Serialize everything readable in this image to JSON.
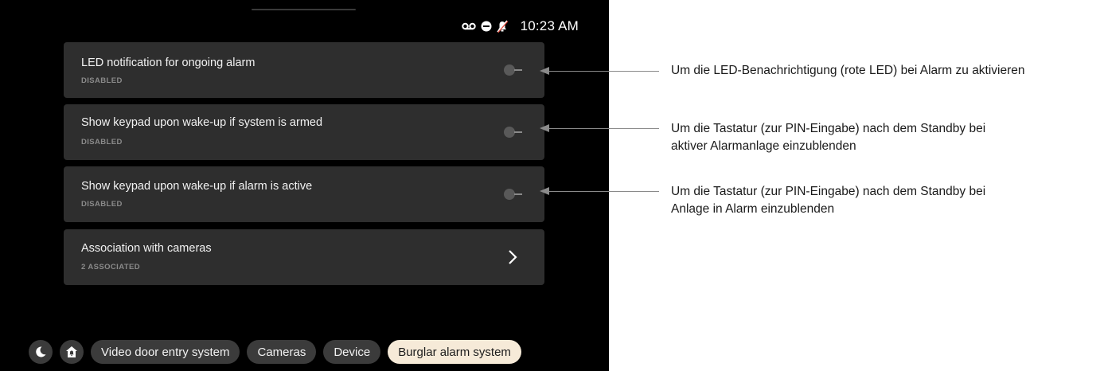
{
  "status_bar": {
    "time": "10:23 AM",
    "icons": [
      "voicemail-icon",
      "do-not-disturb-icon",
      "muted-bell-icon"
    ]
  },
  "settings": [
    {
      "title": "LED notification for ongoing alarm",
      "subtitle": "DISABLED",
      "control": "toggle",
      "enabled": false
    },
    {
      "title": "Show keypad upon wake-up if system is armed",
      "subtitle": "DISABLED",
      "control": "toggle",
      "enabled": false
    },
    {
      "title": "Show keypad upon wake-up if alarm is active",
      "subtitle": "DISABLED",
      "control": "toggle",
      "enabled": false
    },
    {
      "title": "Association with cameras",
      "subtitle": "2 ASSOCIATED",
      "control": "chevron"
    }
  ],
  "nav": {
    "icons": [
      "moon-icon",
      "home-alarm-icon"
    ],
    "tabs": [
      {
        "label": "Video door entry system",
        "active": false
      },
      {
        "label": "Cameras",
        "active": false
      },
      {
        "label": "Device",
        "active": false
      },
      {
        "label": "Burglar alarm system",
        "active": true
      }
    ]
  },
  "annotations": [
    {
      "line1": "Um die LED-Benachrichtigung (rote LED) bei Alarm zu aktivieren",
      "line2": ""
    },
    {
      "line1": "Um die Tastatur (zur PIN-Eingabe) nach dem Standby bei",
      "line2": "aktiver Alarmanlage einzublenden"
    },
    {
      "line1": "Um die Tastatur (zur PIN-Eingabe) nach dem Standby bei",
      "line2": "Anlage in Alarm einzublenden"
    }
  ],
  "colors": {
    "screen_bg": "#000000",
    "card_bg": "#2e2e2e",
    "active_tab_bg": "#f6ead8",
    "callout": "#8a8a8a"
  }
}
